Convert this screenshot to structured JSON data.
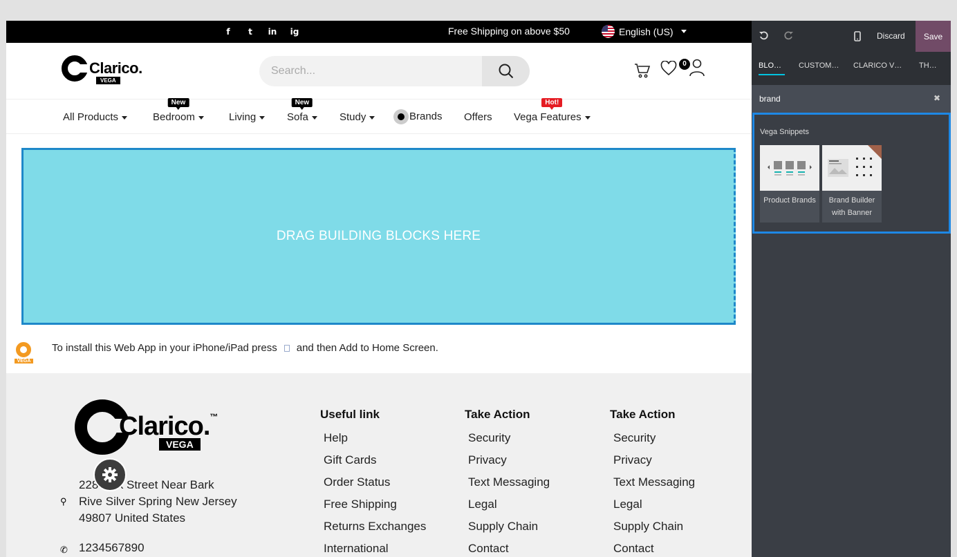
{
  "topbar": {
    "social": [
      "f",
      "t",
      "in",
      "ig"
    ],
    "shipping": "Free Shipping on above $50",
    "language": "English (US)"
  },
  "header": {
    "logo_text": "Clarico.",
    "logo_sub": "VEGA",
    "search_placeholder": "Search...",
    "cart_count": "0"
  },
  "nav": {
    "items": [
      {
        "label": "All Products",
        "tag": ""
      },
      {
        "label": "Bedroom",
        "tag": "New"
      },
      {
        "label": "Living",
        "tag": ""
      },
      {
        "label": "Sofa",
        "tag": "New"
      },
      {
        "label": "Study",
        "tag": ""
      },
      {
        "label": "Brands",
        "tag": ""
      },
      {
        "label": "Offers",
        "tag": ""
      },
      {
        "label": "Vega Features",
        "tag": "Hot!"
      }
    ]
  },
  "dropzone": {
    "text": "DRAG BUILDING BLOCKS HERE"
  },
  "install": {
    "text_before": "To install this Web App in your iPhone/iPad press",
    "text_after": "and then Add to Home Screen.",
    "logo_sub": "VEGA"
  },
  "footer": {
    "logo_text": "Clarico.",
    "logo_tm": "™",
    "logo_sub": "VEGA",
    "address_lines": [
      "228 Oak Street Near Bark",
      "Rive Silver Spring New Jersey",
      "49807 United States"
    ],
    "phone": "1234567890",
    "columns": [
      {
        "title": "Useful link",
        "links": [
          "Help",
          "Gift Cards",
          "Order Status",
          "Free Shipping",
          "Returns Exchanges",
          "International"
        ]
      },
      {
        "title": "Take Action",
        "links": [
          "Security",
          "Privacy",
          "Text Messaging",
          "Legal",
          "Supply Chain",
          "Contact"
        ]
      },
      {
        "title": "Take Action",
        "links": [
          "Security",
          "Privacy",
          "Text Messaging",
          "Legal",
          "Supply Chain",
          "Contact"
        ]
      }
    ]
  },
  "editor": {
    "discard": "Discard",
    "save": "Save",
    "tabs": [
      "BLOCKS",
      "CUSTOMIZE",
      "CLARICO VEGA",
      "THEME"
    ],
    "search_value": "brand",
    "snippets_title": "Vega Snippets",
    "snippets": [
      {
        "label": "Product Brands"
      },
      {
        "label": "Brand Builder with Banner"
      }
    ],
    "accent": "#714b67",
    "highlight": "#1e88e5"
  }
}
